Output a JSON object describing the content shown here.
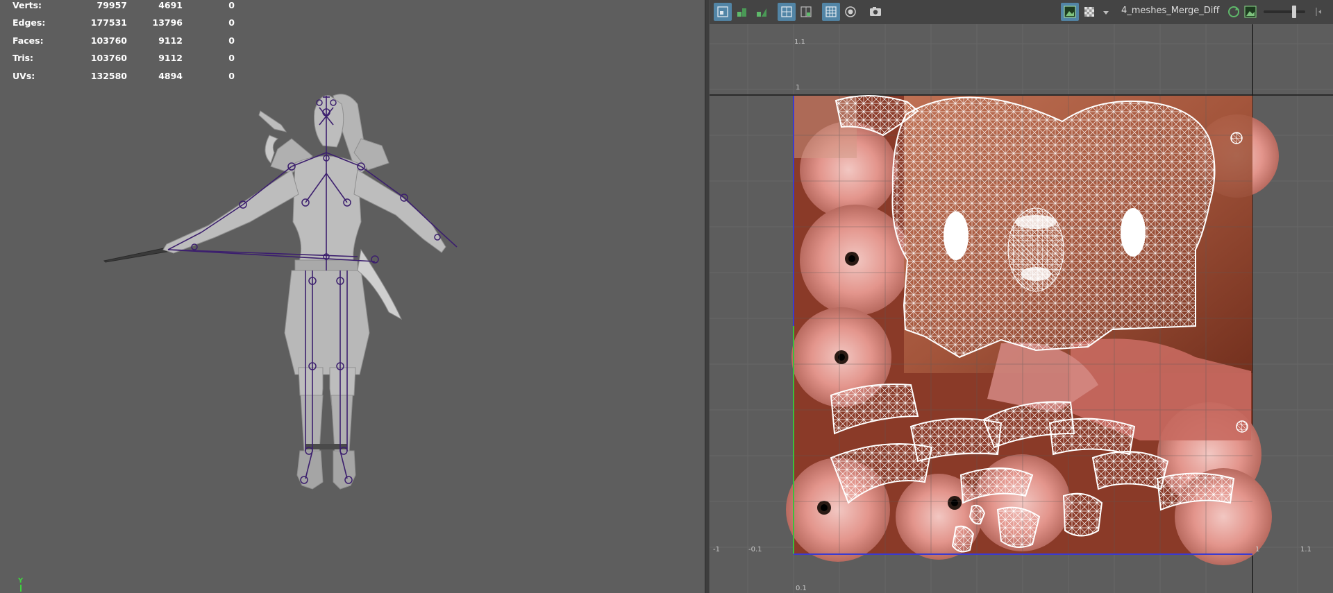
{
  "hud": {
    "rows": [
      {
        "label": "Verts:",
        "c1": "79957",
        "c2": "4691",
        "c3": "0"
      },
      {
        "label": "Edges:",
        "c1": "177531",
        "c2": "13796",
        "c3": "0"
      },
      {
        "label": "Faces:",
        "c1": "103760",
        "c2": "9112",
        "c3": "0"
      },
      {
        "label": "Tris:",
        "c1": "103760",
        "c2": "9112",
        "c3": "0"
      },
      {
        "label": "UVs:",
        "c1": "132580",
        "c2": "4894",
        "c3": "0"
      }
    ]
  },
  "viewport": {
    "axis_label": "Y",
    "bone_color": "#3c1f6e",
    "mesh_color": "#bdbdbd"
  },
  "uv_toolbar": {
    "texture_name": "4_meshes_Merge_Diff",
    "zoom_level": 0.75,
    "accent": "#5285a6",
    "buttons": [
      {
        "name": "uv-shell-icon",
        "active": true
      },
      {
        "name": "stacked-icon",
        "active": false
      },
      {
        "name": "stacked2-icon",
        "active": false
      },
      {
        "name": "grid-icon",
        "active": true
      },
      {
        "name": "grid2-icon",
        "active": false
      },
      {
        "name": "checker-grid-icon",
        "active": true
      },
      {
        "name": "distortion-icon",
        "active": false
      },
      {
        "name": "snapshot-icon",
        "active": false
      },
      {
        "name": "display-image-icon",
        "active": true
      },
      {
        "name": "checker-icon",
        "active": false
      },
      {
        "name": "dropdown-arrow-icon",
        "active": false
      },
      {
        "name": "refresh-icon",
        "active": false
      },
      {
        "name": "image-icon",
        "active": false
      }
    ]
  },
  "uv_labels": {
    "top_left_1": "1.1",
    "top_left_2": "1",
    "bottom_left_1": "-1",
    "bottom_left_2": "-0.1",
    "bottom_right_1": "1",
    "bottom_right_2": "1.1",
    "bottom_left_3": "0.1"
  }
}
